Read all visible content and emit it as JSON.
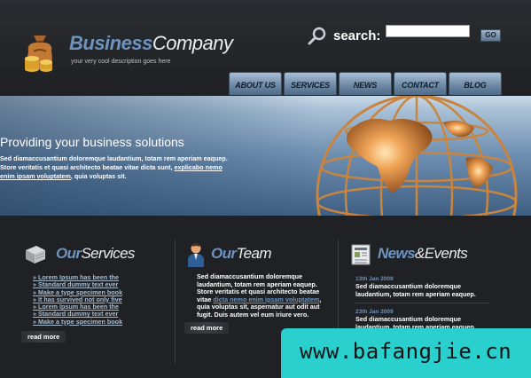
{
  "header": {
    "title_part1": "Business",
    "title_part2": "Company",
    "tagline": "your very cool description goes here",
    "search_label": "search:",
    "search_value": "",
    "go_label": "GO"
  },
  "nav": {
    "items": [
      "ABOUT US",
      "SERVICES",
      "NEWS",
      "CONTACT",
      "BLOG"
    ]
  },
  "banner": {
    "title": "Providing your business solutions",
    "text_main": "Sed diamaccusantium doloremque laudantium, totam rem aperiam eaquep. Store veritatis et quasi architecto beatae vitae dicta sunt, ",
    "text_link": "explicabo nemo enim ipsam voluptatem",
    "text_tail": ", quia voluptas sit."
  },
  "services": {
    "title_a": "Our",
    "title_b": "Services",
    "items": [
      "» Lorem Ipsum has been the",
      "» Standard dummy text ever",
      "» Make a type specimen book",
      "» It has survived not only five",
      "» Lorem Ipsum has been the",
      "» Standard dummy text ever",
      "» Make a type specimen book"
    ],
    "read_more": "read more"
  },
  "team": {
    "title_a": "Our",
    "title_b": "Team",
    "text_main": "Sed diamaccusantium doloremque laudantium, totam rem aperiam eaquep. Store veritatis et quasi architecto beatae vitae ",
    "text_link": "dicta nemo enim ipsam voluptatem",
    "text_tail": ", quia voluptas sit, aspernatur aut odit aut fugit. Duis autem vel eum iriure vero.",
    "read_more": "read more"
  },
  "news": {
    "title_a": "News",
    "title_amp": "&",
    "title_b": "Events",
    "items": [
      {
        "date": "13th Jan 2009",
        "text": "Sed diamaccusantium doloremque laudantium, totam rem aperiam eaquep."
      },
      {
        "date": "23th Jan 2009",
        "text": "Sed diamaccusantium doloremque laudantium, totam rem aperiam eaquep."
      }
    ]
  },
  "watermark": {
    "text": "www.bafangjie.cn"
  },
  "colors": {
    "accent": "#6e93bf",
    "background": "#1f2124",
    "nav": "#8aa4bf",
    "watermark": "#2ad0cd"
  },
  "icons": [
    "money-bag-icon",
    "search-icon",
    "book-icon",
    "person-icon",
    "newspaper-icon",
    "globe-icon"
  ]
}
